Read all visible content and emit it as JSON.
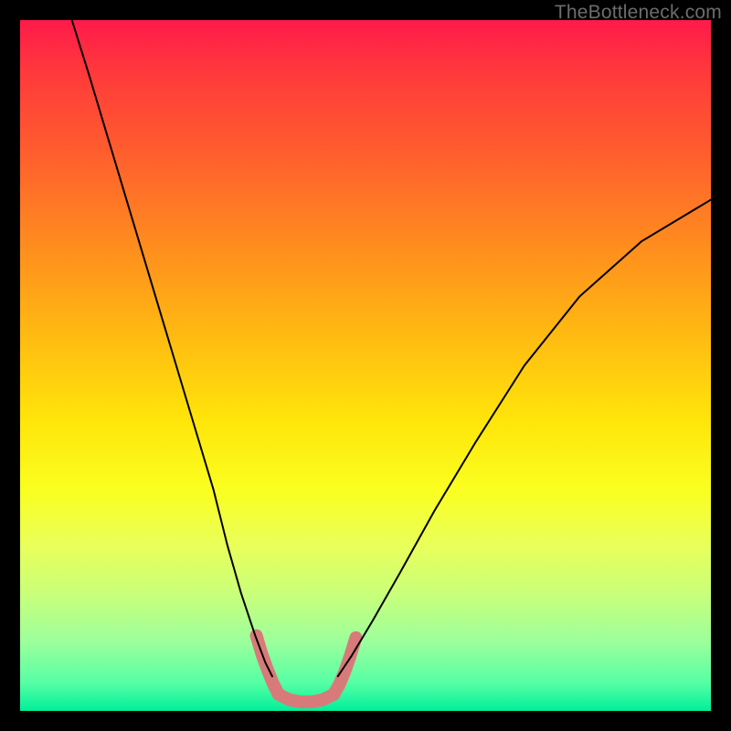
{
  "watermark": "TheBottleneck.com",
  "chart_data": {
    "type": "line",
    "title": "",
    "xlabel": "",
    "ylabel": "",
    "xlim": [
      0,
      100
    ],
    "ylim": [
      0,
      100
    ],
    "grid": false,
    "legend": false,
    "background_gradient": {
      "orientation": "vertical",
      "stops": [
        {
          "pos": 0,
          "color": "#ff1a4a"
        },
        {
          "pos": 50,
          "color": "#ffe50a"
        },
        {
          "pos": 100,
          "color": "#00ef9a"
        }
      ]
    },
    "series": [
      {
        "name": "curve-left",
        "stroke": "#000000",
        "stroke_width": 2,
        "x": [
          7.5,
          10,
          13,
          16,
          19,
          22,
          25,
          28,
          30,
          32,
          34,
          35.5,
          36.5
        ],
        "y": [
          100,
          92,
          82,
          72,
          62,
          52,
          42,
          32,
          24,
          17,
          11,
          7,
          5
        ]
      },
      {
        "name": "curve-right",
        "stroke": "#000000",
        "stroke_width": 2,
        "x": [
          46,
          48,
          51,
          55,
          60,
          66,
          73,
          81,
          90,
          100
        ],
        "y": [
          5,
          8,
          13,
          20,
          29,
          39,
          50,
          60,
          68,
          74
        ]
      },
      {
        "name": "highlight-left",
        "stroke": "#d97a7a",
        "stroke_width": 14,
        "x": [
          34.2,
          35.0,
          35.8,
          36.6,
          37.4
        ],
        "y": [
          10.9,
          8.2,
          6.0,
          4.0,
          2.4
        ]
      },
      {
        "name": "highlight-bottom",
        "stroke": "#d97a7a",
        "stroke_width": 14,
        "x": [
          37.4,
          39.0,
          40.6,
          42.2,
          43.8,
          45.4
        ],
        "y": [
          2.4,
          1.6,
          1.3,
          1.3,
          1.6,
          2.4
        ]
      },
      {
        "name": "highlight-right",
        "stroke": "#d97a7a",
        "stroke_width": 14,
        "x": [
          45.4,
          46.2,
          47.0,
          47.8,
          48.6
        ],
        "y": [
          2.4,
          3.8,
          5.7,
          8.0,
          10.6
        ]
      }
    ]
  }
}
